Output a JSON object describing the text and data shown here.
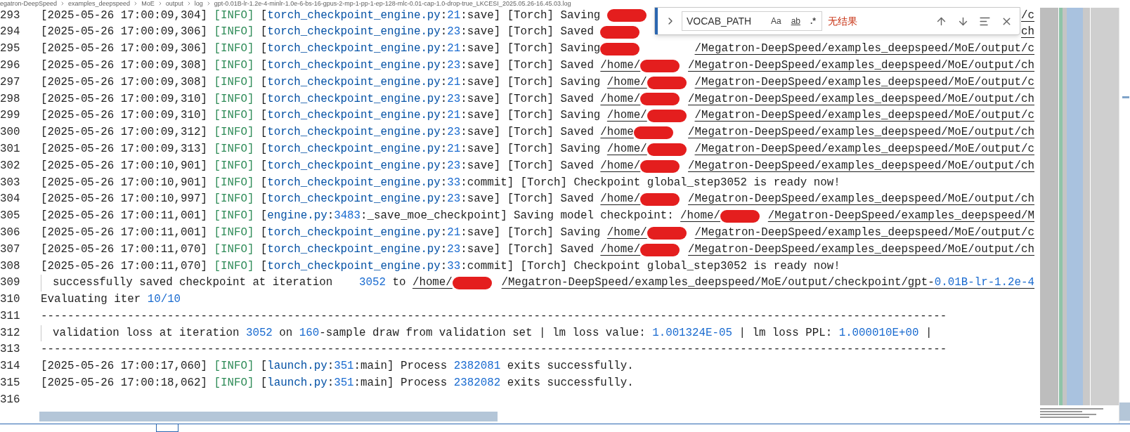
{
  "breadcrumb": [
    "egatron-DeepSpeed",
    "examples_deepspeed",
    "MoE",
    "output",
    "log",
    "gpt-0.01B-lr-1.2e-4-minlr-1.0e-6-bs-16-gpus-2-mp-1-pp-1-ep-128-mlc-0.01-cap-1.0-drop-true_LKCESI_2025.05.26-16.45.03.log"
  ],
  "editor": {
    "lines": [
      {
        "number": "293",
        "kind": "log",
        "segments": [
          {
            "kind": "plain",
            "text": "[2025-05-26 17:00:09,304] "
          },
          {
            "kind": "info",
            "text": "[INFO]"
          },
          {
            "kind": "plain",
            "text": " ["
          },
          {
            "kind": "module",
            "text": "torch_checkpoint_engine.py"
          },
          {
            "kind": "plain",
            "text": ":"
          },
          {
            "kind": "num",
            "text": "21"
          },
          {
            "kind": "plain",
            "text": ":save] [Torch] Saving "
          },
          {
            "kind": "redacted"
          },
          {
            "kind": "path",
            "text": "/c"
          }
        ]
      },
      {
        "number": "294",
        "kind": "log",
        "segments": [
          {
            "kind": "plain",
            "text": "[2025-05-26 17:00:09,306] "
          },
          {
            "kind": "info",
            "text": "[INFO]"
          },
          {
            "kind": "plain",
            "text": " ["
          },
          {
            "kind": "module",
            "text": "torch_checkpoint_engine.py"
          },
          {
            "kind": "plain",
            "text": ":"
          },
          {
            "kind": "num",
            "text": "23"
          },
          {
            "kind": "plain",
            "text": ":save] [Torch] Saved "
          },
          {
            "kind": "redacted"
          },
          {
            "kind": "path",
            "text": "ch"
          }
        ]
      },
      {
        "number": "295",
        "kind": "log",
        "segments": [
          {
            "kind": "plain",
            "text": "[2025-05-26 17:00:09,306] "
          },
          {
            "kind": "info",
            "text": "[INFO]"
          },
          {
            "kind": "plain",
            "text": " ["
          },
          {
            "kind": "module",
            "text": "torch_checkpoint_engine.py"
          },
          {
            "kind": "plain",
            "text": ":"
          },
          {
            "kind": "num",
            "text": "21"
          },
          {
            "kind": "plain",
            "text": ":save] [Torch] Saving"
          },
          {
            "kind": "redacted"
          },
          {
            "kind": "path",
            "text": "/Megatron-DeepSpeed/examples_deepspeed/MoE/output/c"
          }
        ]
      },
      {
        "number": "296",
        "kind": "log",
        "segments": [
          {
            "kind": "plain",
            "text": "[2025-05-26 17:00:09,308] "
          },
          {
            "kind": "info",
            "text": "[INFO]"
          },
          {
            "kind": "plain",
            "text": " ["
          },
          {
            "kind": "module",
            "text": "torch_checkpoint_engine.py"
          },
          {
            "kind": "plain",
            "text": ":"
          },
          {
            "kind": "num",
            "text": "23"
          },
          {
            "kind": "plain",
            "text": ":save] [Torch] Saved "
          },
          {
            "kind": "path",
            "text": "/home/"
          },
          {
            "kind": "redacted"
          },
          {
            "kind": "path",
            "text": "/Megatron-DeepSpeed/examples_deepspeed/MoE/output/ch"
          }
        ]
      },
      {
        "number": "297",
        "kind": "log",
        "segments": [
          {
            "kind": "plain",
            "text": "[2025-05-26 17:00:09,308] "
          },
          {
            "kind": "info",
            "text": "[INFO]"
          },
          {
            "kind": "plain",
            "text": " ["
          },
          {
            "kind": "module",
            "text": "torch_checkpoint_engine.py"
          },
          {
            "kind": "plain",
            "text": ":"
          },
          {
            "kind": "num",
            "text": "21"
          },
          {
            "kind": "plain",
            "text": ":save] [Torch] Saving "
          },
          {
            "kind": "path",
            "text": "/home/"
          },
          {
            "kind": "redacted"
          },
          {
            "kind": "path",
            "text": "/Megatron-DeepSpeed/examples_deepspeed/MoE/output/c"
          }
        ]
      },
      {
        "number": "298",
        "kind": "log",
        "segments": [
          {
            "kind": "plain",
            "text": "[2025-05-26 17:00:09,310] "
          },
          {
            "kind": "info",
            "text": "[INFO]"
          },
          {
            "kind": "plain",
            "text": " ["
          },
          {
            "kind": "module",
            "text": "torch_checkpoint_engine.py"
          },
          {
            "kind": "plain",
            "text": ":"
          },
          {
            "kind": "num",
            "text": "23"
          },
          {
            "kind": "plain",
            "text": ":save] [Torch] Saved "
          },
          {
            "kind": "path",
            "text": "/home/"
          },
          {
            "kind": "redacted"
          },
          {
            "kind": "path",
            "text": "/Megatron-DeepSpeed/examples_deepspeed/MoE/output/ch"
          }
        ]
      },
      {
        "number": "299",
        "kind": "log",
        "segments": [
          {
            "kind": "plain",
            "text": "[2025-05-26 17:00:09,310] "
          },
          {
            "kind": "info",
            "text": "[INFO]"
          },
          {
            "kind": "plain",
            "text": " ["
          },
          {
            "kind": "module",
            "text": "torch_checkpoint_engine.py"
          },
          {
            "kind": "plain",
            "text": ":"
          },
          {
            "kind": "num",
            "text": "21"
          },
          {
            "kind": "plain",
            "text": ":save] [Torch] Saving "
          },
          {
            "kind": "path",
            "text": "/home/"
          },
          {
            "kind": "redacted"
          },
          {
            "kind": "path",
            "text": "/Megatron-DeepSpeed/examples_deepspeed/MoE/output/c"
          }
        ]
      },
      {
        "number": "300",
        "kind": "log",
        "segments": [
          {
            "kind": "plain",
            "text": "[2025-05-26 17:00:09,312] "
          },
          {
            "kind": "info",
            "text": "[INFO]"
          },
          {
            "kind": "plain",
            "text": " ["
          },
          {
            "kind": "module",
            "text": "torch_checkpoint_engine.py"
          },
          {
            "kind": "plain",
            "text": ":"
          },
          {
            "kind": "num",
            "text": "23"
          },
          {
            "kind": "plain",
            "text": ":save] [Torch] Saved "
          },
          {
            "kind": "path",
            "text": "/home"
          },
          {
            "kind": "redacted"
          },
          {
            "kind": "path",
            "text": "/Megatron-DeepSpeed/examples_deepspeed/MoE/output/ch"
          }
        ]
      },
      {
        "number": "301",
        "kind": "log",
        "segments": [
          {
            "kind": "plain",
            "text": "[2025-05-26 17:00:09,313] "
          },
          {
            "kind": "info",
            "text": "[INFO]"
          },
          {
            "kind": "plain",
            "text": " ["
          },
          {
            "kind": "module",
            "text": "torch_checkpoint_engine.py"
          },
          {
            "kind": "plain",
            "text": ":"
          },
          {
            "kind": "num",
            "text": "21"
          },
          {
            "kind": "plain",
            "text": ":save] [Torch] Saving "
          },
          {
            "kind": "path",
            "text": "/home/"
          },
          {
            "kind": "redacted"
          },
          {
            "kind": "path",
            "text": "/Megatron-DeepSpeed/examples_deepspeed/MoE/output/c"
          }
        ]
      },
      {
        "number": "302",
        "kind": "log",
        "segments": [
          {
            "kind": "plain",
            "text": "[2025-05-26 17:00:10,901] "
          },
          {
            "kind": "info",
            "text": "[INFO]"
          },
          {
            "kind": "plain",
            "text": " ["
          },
          {
            "kind": "module",
            "text": "torch_checkpoint_engine.py"
          },
          {
            "kind": "plain",
            "text": ":"
          },
          {
            "kind": "num",
            "text": "23"
          },
          {
            "kind": "plain",
            "text": ":save] [Torch] Saved "
          },
          {
            "kind": "path",
            "text": "/home/"
          },
          {
            "kind": "redacted"
          },
          {
            "kind": "path",
            "text": "/Megatron-DeepSpeed/examples_deepspeed/MoE/output/ch"
          }
        ]
      },
      {
        "number": "303",
        "kind": "log",
        "segments": [
          {
            "kind": "plain",
            "text": "[2025-05-26 17:00:10,901] "
          },
          {
            "kind": "info",
            "text": "[INFO]"
          },
          {
            "kind": "plain",
            "text": " ["
          },
          {
            "kind": "module",
            "text": "torch_checkpoint_engine.py"
          },
          {
            "kind": "plain",
            "text": ":"
          },
          {
            "kind": "num",
            "text": "33"
          },
          {
            "kind": "plain",
            "text": ":commit] [Torch] Checkpoint global_step3052 is ready now!"
          }
        ]
      },
      {
        "number": "304",
        "kind": "log",
        "segments": [
          {
            "kind": "plain",
            "text": "[2025-05-26 17:00:10,997] "
          },
          {
            "kind": "info",
            "text": "[INFO]"
          },
          {
            "kind": "plain",
            "text": " ["
          },
          {
            "kind": "module",
            "text": "torch_checkpoint_engine.py"
          },
          {
            "kind": "plain",
            "text": ":"
          },
          {
            "kind": "num",
            "text": "23"
          },
          {
            "kind": "plain",
            "text": ":save] [Torch] Saved "
          },
          {
            "kind": "path",
            "text": "/home/"
          },
          {
            "kind": "redacted"
          },
          {
            "kind": "path",
            "text": "/Megatron-DeepSpeed/examples_deepspeed/MoE/output/ch"
          }
        ]
      },
      {
        "number": "305",
        "kind": "log",
        "segments": [
          {
            "kind": "plain",
            "text": "[2025-05-26 17:00:11,001] "
          },
          {
            "kind": "info",
            "text": "[INFO]"
          },
          {
            "kind": "plain",
            "text": " ["
          },
          {
            "kind": "module",
            "text": "engine.py"
          },
          {
            "kind": "plain",
            "text": ":"
          },
          {
            "kind": "num",
            "text": "3483"
          },
          {
            "kind": "plain",
            "text": ":_save_moe_checkpoint] Saving model checkpoint: "
          },
          {
            "kind": "path",
            "text": "/home/"
          },
          {
            "kind": "redacted"
          },
          {
            "kind": "path",
            "text": "/Megatron-DeepSpeed/examples_deepspeed/M"
          }
        ]
      },
      {
        "number": "306",
        "kind": "log",
        "segments": [
          {
            "kind": "plain",
            "text": "[2025-05-26 17:00:11,001] "
          },
          {
            "kind": "info",
            "text": "[INFO]"
          },
          {
            "kind": "plain",
            "text": " ["
          },
          {
            "kind": "module",
            "text": "torch_checkpoint_engine.py"
          },
          {
            "kind": "plain",
            "text": ":"
          },
          {
            "kind": "num",
            "text": "21"
          },
          {
            "kind": "plain",
            "text": ":save] [Torch] Saving "
          },
          {
            "kind": "path",
            "text": "/home/"
          },
          {
            "kind": "redacted"
          },
          {
            "kind": "path",
            "text": "/Megatron-DeepSpeed/examples_deepspeed/MoE/output/c"
          }
        ]
      },
      {
        "number": "307",
        "kind": "log",
        "segments": [
          {
            "kind": "plain",
            "text": "[2025-05-26 17:00:11,070] "
          },
          {
            "kind": "info",
            "text": "[INFO]"
          },
          {
            "kind": "plain",
            "text": " ["
          },
          {
            "kind": "module",
            "text": "torch_checkpoint_engine.py"
          },
          {
            "kind": "plain",
            "text": ":"
          },
          {
            "kind": "num",
            "text": "23"
          },
          {
            "kind": "plain",
            "text": ":save] [Torch] Saved "
          },
          {
            "kind": "path",
            "text": "/home/"
          },
          {
            "kind": "redacted"
          },
          {
            "kind": "path",
            "text": "/Megatron-DeepSpeed/examples_deepspeed/MoE/output/ch"
          }
        ]
      },
      {
        "number": "308",
        "kind": "log",
        "segments": [
          {
            "kind": "plain",
            "text": "[2025-05-26 17:00:11,070] "
          },
          {
            "kind": "info",
            "text": "[INFO]"
          },
          {
            "kind": "plain",
            "text": " ["
          },
          {
            "kind": "module",
            "text": "torch_checkpoint_engine.py"
          },
          {
            "kind": "plain",
            "text": ":"
          },
          {
            "kind": "num",
            "text": "33"
          },
          {
            "kind": "plain",
            "text": ":commit] [Torch] Checkpoint global_step3052 is ready now!"
          }
        ]
      },
      {
        "number": "309",
        "kind": "guide",
        "segments": [
          {
            "kind": "plain",
            "text": "successfully saved checkpoint at iteration    "
          },
          {
            "kind": "num",
            "text": "3052"
          },
          {
            "kind": "plain",
            "text": " to "
          },
          {
            "kind": "path",
            "text": "/home/"
          },
          {
            "kind": "redacted"
          },
          {
            "kind": "path",
            "text": "/Megatron-DeepSpeed/examples_deepspeed/MoE/output/checkpoint/gpt-"
          },
          {
            "kind": "pathnum",
            "text": "0.01B-lr-1.2e-4"
          }
        ]
      },
      {
        "number": "310",
        "kind": "log",
        "segments": [
          {
            "kind": "plain",
            "text": "Evaluating iter "
          },
          {
            "kind": "num",
            "text": "10/10"
          }
        ]
      },
      {
        "number": "311",
        "kind": "log",
        "segments": [
          {
            "kind": "plain",
            "text": "----------------------------------------------------------------------------------------------------------------------------------------"
          }
        ]
      },
      {
        "number": "312",
        "kind": "guide",
        "segments": [
          {
            "kind": "plain",
            "text": "validation loss at iteration "
          },
          {
            "kind": "num",
            "text": "3052"
          },
          {
            "kind": "plain",
            "text": " on "
          },
          {
            "kind": "num",
            "text": "160"
          },
          {
            "kind": "plain",
            "text": "-sample draw from validation set | lm loss value: "
          },
          {
            "kind": "num",
            "text": "1.001324E-05"
          },
          {
            "kind": "plain",
            "text": " | lm loss PPL: "
          },
          {
            "kind": "num",
            "text": "1.000010E+00"
          },
          {
            "kind": "plain",
            "text": " |"
          }
        ]
      },
      {
        "number": "313",
        "kind": "log",
        "segments": [
          {
            "kind": "plain",
            "text": "----------------------------------------------------------------------------------------------------------------------------------------"
          }
        ]
      },
      {
        "number": "314",
        "kind": "log",
        "segments": [
          {
            "kind": "plain",
            "text": "[2025-05-26 17:00:17,060] "
          },
          {
            "kind": "info",
            "text": "[INFO]"
          },
          {
            "kind": "plain",
            "text": " ["
          },
          {
            "kind": "module",
            "text": "launch.py"
          },
          {
            "kind": "plain",
            "text": ":"
          },
          {
            "kind": "num",
            "text": "351"
          },
          {
            "kind": "plain",
            "text": ":main] Process "
          },
          {
            "kind": "num",
            "text": "2382081"
          },
          {
            "kind": "plain",
            "text": " exits successfully."
          }
        ]
      },
      {
        "number": "315",
        "kind": "log",
        "segments": [
          {
            "kind": "plain",
            "text": "[2025-05-26 17:00:18,062] "
          },
          {
            "kind": "info",
            "text": "[INFO]"
          },
          {
            "kind": "plain",
            "text": " ["
          },
          {
            "kind": "module",
            "text": "launch.py"
          },
          {
            "kind": "plain",
            "text": ":"
          },
          {
            "kind": "num",
            "text": "351"
          },
          {
            "kind": "plain",
            "text": ":main] Process "
          },
          {
            "kind": "num",
            "text": "2382082"
          },
          {
            "kind": "plain",
            "text": " exits successfully."
          }
        ]
      },
      {
        "number": "316",
        "kind": "log"
      }
    ]
  },
  "find_widget": {
    "query": "VOCAB_PATH",
    "options": [
      {
        "label": "Aa",
        "on": false
      },
      {
        "label": "ab",
        "on": false
      },
      {
        "label": ".*",
        "on": false
      }
    ],
    "result": "无结果"
  }
}
